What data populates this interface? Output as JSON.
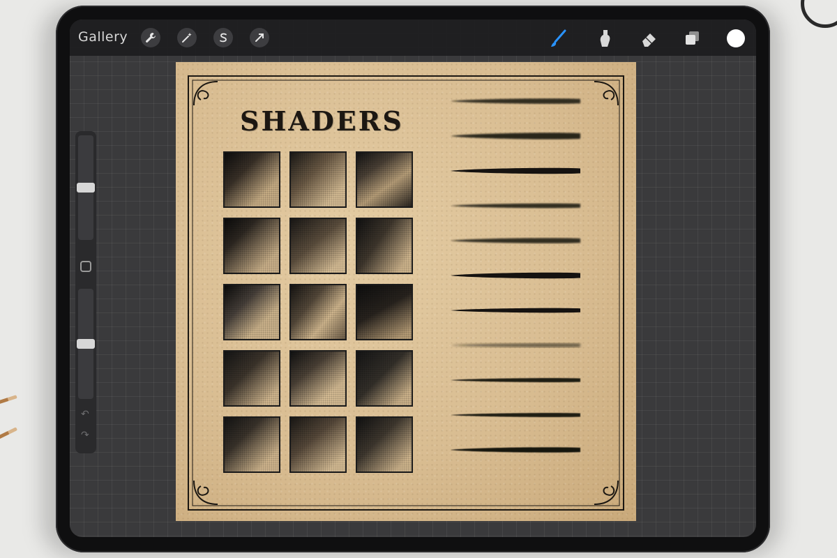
{
  "toolbar": {
    "gallery_label": "Gallery",
    "left_tools": [
      {
        "name": "actions-wrench-icon"
      },
      {
        "name": "adjustments-wand-icon"
      },
      {
        "name": "selection-s-icon"
      },
      {
        "name": "transform-arrow-icon"
      }
    ],
    "right_tools": [
      {
        "name": "brush-icon",
        "active": true
      },
      {
        "name": "smudge-icon"
      },
      {
        "name": "eraser-icon"
      },
      {
        "name": "layers-icon"
      }
    ],
    "active_color": "#ffffff",
    "accent_color": "#1e90ff"
  },
  "sidebar": {
    "brush_size_level": 0.5,
    "opacity_level": 0.5,
    "undo_glyph": "↶",
    "redo_glyph": "↷"
  },
  "canvas": {
    "title": "SHADERS",
    "swatch_rows": 5,
    "swatch_cols": 3,
    "stroke_count": 11
  }
}
